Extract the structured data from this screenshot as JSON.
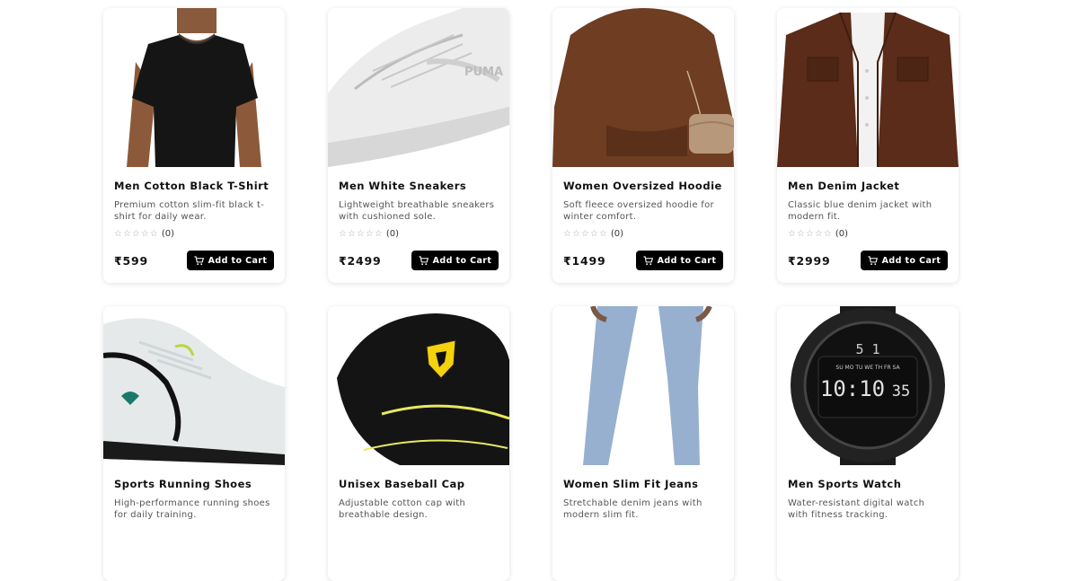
{
  "products": [
    {
      "name": "Men Cotton Black T-Shirt",
      "description": "Premium cotton slim-fit black t-shirt for daily wear.",
      "rating_count": "(0)",
      "price": "₹599",
      "cta": "Add to Cart",
      "image": "black-tshirt-image"
    },
    {
      "name": "Men White Sneakers",
      "description": "Lightweight breathable sneakers with cushioned sole.",
      "rating_count": "(0)",
      "price": "₹2499",
      "cta": "Add to Cart",
      "image": "white-sneaker-image",
      "image_text": "PUMA"
    },
    {
      "name": "Women Oversized Hoodie",
      "description": "Soft fleece oversized hoodie for winter comfort.",
      "rating_count": "(0)",
      "price": "₹1499",
      "cta": "Add to Cart",
      "image": "brown-hoodie-image"
    },
    {
      "name": "Men Denim Jacket",
      "description": "Classic blue denim jacket with modern fit.",
      "rating_count": "(0)",
      "price": "₹2999",
      "cta": "Add to Cart",
      "image": "denim-jacket-image"
    },
    {
      "name": "Sports Running Shoes",
      "description": "High-performance running shoes for daily training.",
      "image": "running-shoe-image"
    },
    {
      "name": "Unisex Baseball Cap",
      "description": "Adjustable cotton cap with breathable design.",
      "image": "baseball-cap-image"
    },
    {
      "name": "Women Slim Fit Jeans",
      "description": "Stretchable denim jeans with modern slim fit.",
      "image": "slim-jeans-image"
    },
    {
      "name": "Men Sports Watch",
      "description": "Water-resistant digital watch with fitness tracking.",
      "image": "sports-watch-image",
      "image_text": {
        "days": "SU MO TU WE TH FR SA",
        "time": "10:10",
        "seconds": "35",
        "top_digit": "5 1"
      }
    }
  ],
  "stars": "☆☆☆☆☆"
}
